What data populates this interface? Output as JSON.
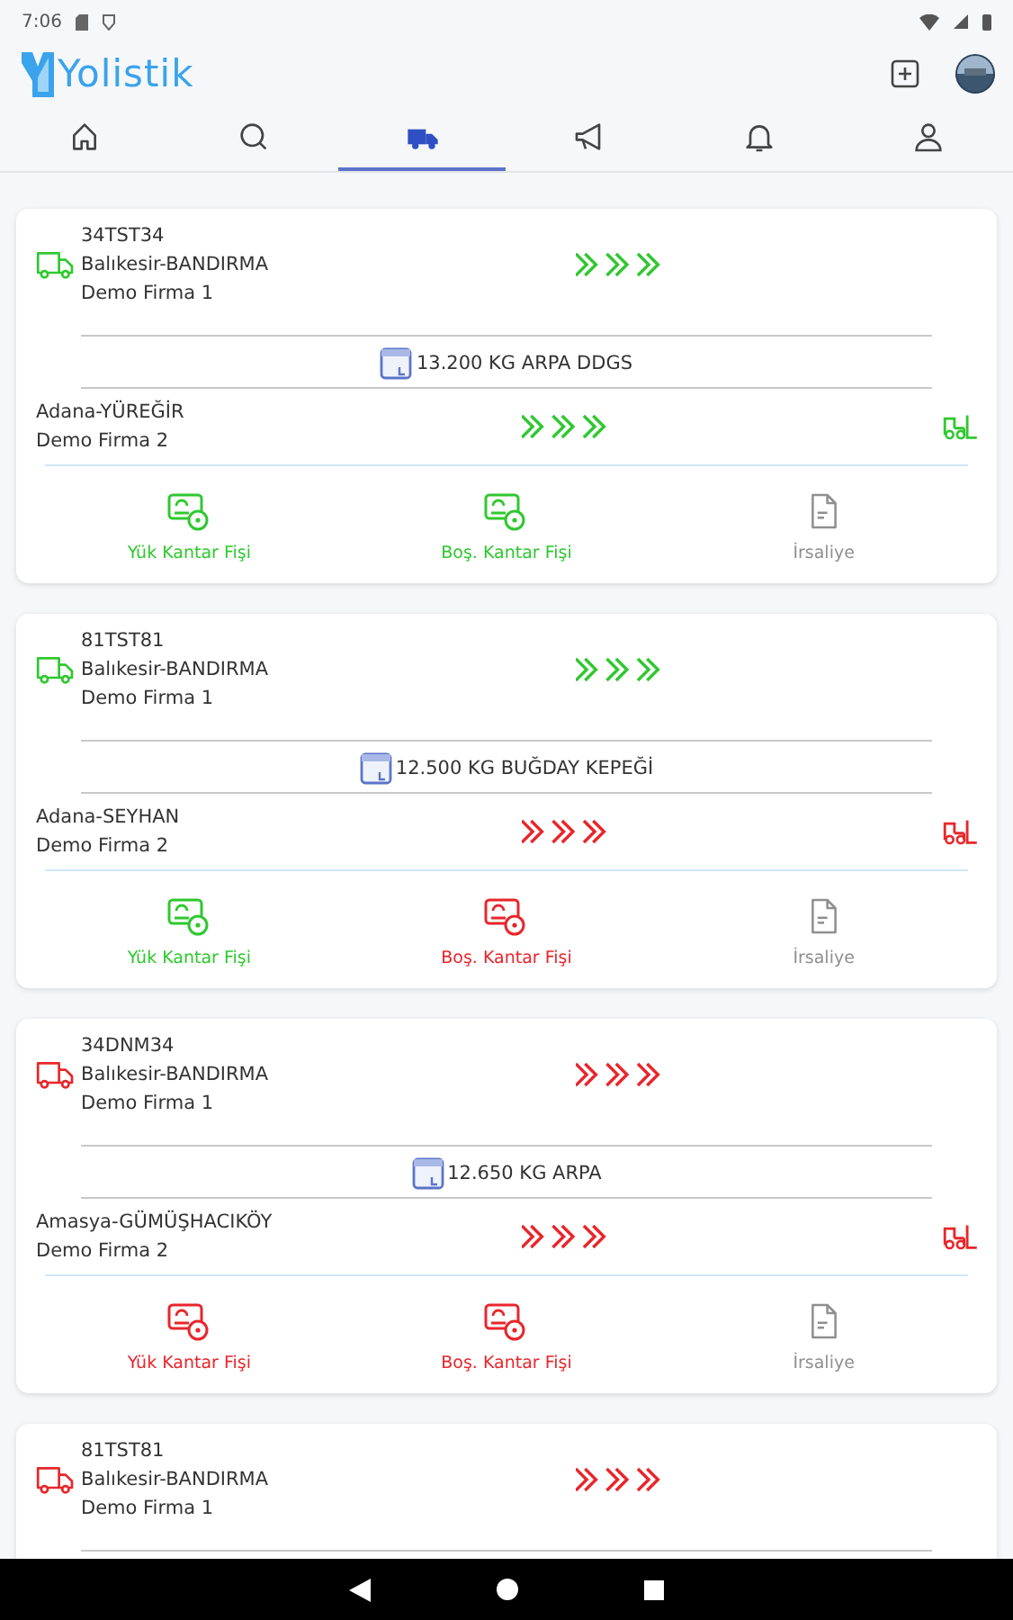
{
  "status_bar": {
    "time": "7:06"
  },
  "app_bar": {
    "logo_text": "Yolistik"
  },
  "tabs": [
    {
      "selected": false
    },
    {
      "selected": false
    },
    {
      "selected": true
    },
    {
      "selected": false
    },
    {
      "selected": false
    },
    {
      "selected": false
    }
  ],
  "shipments": [
    {
      "plate": "34TST34",
      "origin": "Balıkesir-BANDIRMA",
      "origin_company": "Demo Firma 1",
      "origin_done": true,
      "cargo": "13.200 KG ARPA DDGS",
      "destination": "Adana-YÜREĞİR",
      "destination_company": "Demo Firma 2",
      "destination_done": true,
      "documents": [
        {
          "label": "Yük Kantar Fişi",
          "done": true,
          "disabled": false
        },
        {
          "label": "Boş. Kantar Fişi",
          "done": true,
          "disabled": false
        },
        {
          "label": "İrsaliye",
          "disabled": true
        }
      ]
    },
    {
      "plate": "81TST81",
      "origin": "Balıkesir-BANDIRMA",
      "origin_company": "Demo Firma 1",
      "origin_done": true,
      "cargo": "12.500 KG BUĞDAY KEPEĞİ",
      "destination": "Adana-SEYHAN",
      "destination_company": "Demo Firma 2",
      "destination_done": false,
      "documents": [
        {
          "label": "Yük Kantar Fişi",
          "done": true,
          "disabled": false
        },
        {
          "label": "Boş. Kantar Fişi",
          "done": false,
          "disabled": false
        },
        {
          "label": "İrsaliye",
          "disabled": true
        }
      ]
    },
    {
      "plate": "34DNM34",
      "origin": "Balıkesir-BANDIRMA",
      "origin_company": "Demo Firma 1",
      "origin_done": false,
      "cargo": "12.650 KG ARPA",
      "destination": "Amasya-GÜMÜŞHACIKÖY",
      "destination_company": "Demo Firma 2",
      "destination_done": false,
      "documents": [
        {
          "label": "Yük Kantar Fişi",
          "done": false,
          "disabled": false
        },
        {
          "label": "Boş. Kantar Fişi",
          "done": false,
          "disabled": false
        },
        {
          "label": "İrsaliye",
          "disabled": true
        }
      ]
    },
    {
      "plate": "81TST81",
      "origin": "Balıkesir-BANDIRMA",
      "origin_company": "Demo Firma 1",
      "origin_done": false
    }
  ]
}
